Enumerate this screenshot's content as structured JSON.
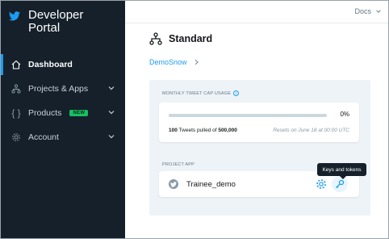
{
  "sidebar": {
    "brand_title": "Developer Portal",
    "items": [
      {
        "label": "Dashboard",
        "icon": "home-icon",
        "active": true
      },
      {
        "label": "Projects & Apps",
        "icon": "projects-icon",
        "expandable": true
      },
      {
        "label": "Products",
        "icon": "braces-icon",
        "badge": "NEW",
        "expandable": true
      },
      {
        "label": "Account",
        "icon": "gear-icon",
        "expandable": true
      }
    ]
  },
  "topbar": {
    "docs_label": "Docs"
  },
  "main": {
    "title": "Standard",
    "breadcrumb": "DemoSnow",
    "usage": {
      "label": "MONTHLY TWEET CAP USAGE",
      "percent_label": "0%",
      "percent_value": 0,
      "count": "100",
      "count_text": " Tweets pulled of ",
      "cap": "500,000",
      "reset_text": "Resets on June 18 at 00:00 UTC"
    },
    "project_app": {
      "label": "PROJECT APP",
      "app_name": "Trainee_demo",
      "tooltip": "Keys and tokens"
    }
  },
  "colors": {
    "sidebar_bg": "#15202b",
    "accent": "#1d9bf0",
    "badge_green": "#17bf63",
    "panel_bg": "#eef3f7"
  }
}
